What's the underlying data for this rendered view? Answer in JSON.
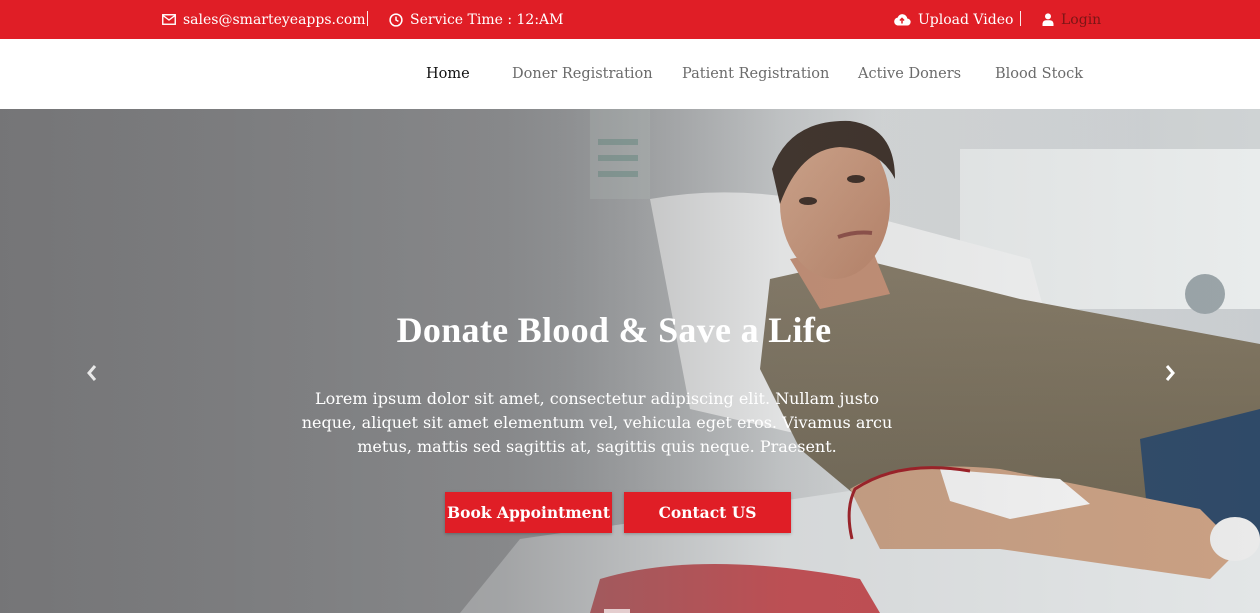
{
  "topbar": {
    "email": "sales@smarteyeapps.com",
    "service_time": "Service Time : 12:AM",
    "upload_video": "Upload Video",
    "login": "Login",
    "bg_color": "#e01e26",
    "icons": [
      "envelope-icon",
      "clock-icon",
      "cloud-upload-icon",
      "user-icon"
    ]
  },
  "nav": {
    "items": [
      {
        "label": "Home"
      },
      {
        "label": "Doner Registration"
      },
      {
        "label": "Patient Registration"
      },
      {
        "label": "Active Doners"
      },
      {
        "label": "Blood Stock"
      }
    ],
    "active": "Home"
  },
  "hero": {
    "title": "Donate Blood & Save a Life",
    "description": "Lorem ipsum dolor sit amet, consectetur adipiscing elit. Nullam justo neque, aliquet sit amet elementum vel, vehicula eget eros. Vivamus arcu metus, mattis sed sagittis at, sagittis quis neque. Praesent.",
    "buttons": {
      "book": "Book Appointment",
      "contact": "Contact US"
    },
    "accent_color": "#e01e26",
    "icons": [
      "chevron-left-icon",
      "chevron-right-icon"
    ]
  }
}
